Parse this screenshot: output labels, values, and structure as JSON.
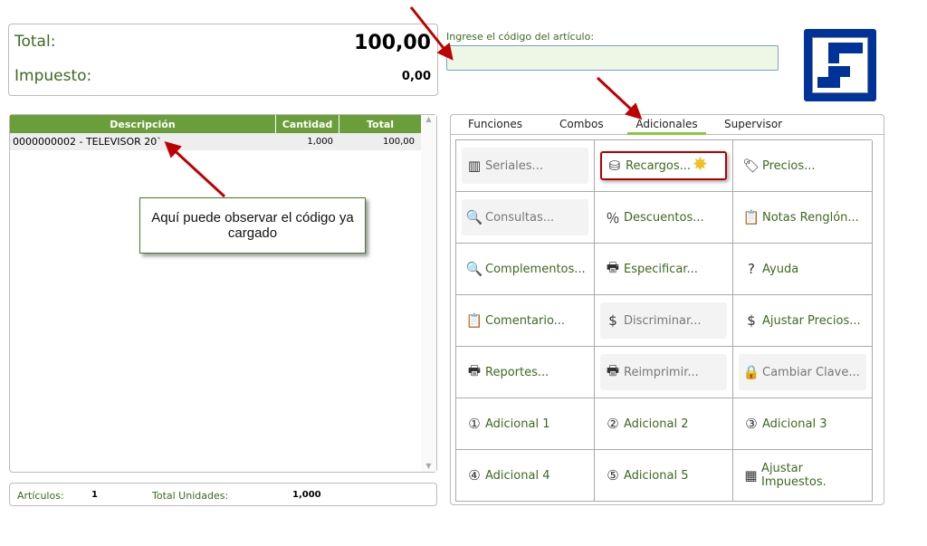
{
  "totals": {
    "total_label": "Total:",
    "total_value": "100,00",
    "tax_label": "Impuesto:",
    "tax_value": "0,00"
  },
  "code": {
    "label": "Ingrese el código del artículo:",
    "value": ""
  },
  "table": {
    "headers": [
      "Descripción",
      "Cantidad",
      "Total"
    ],
    "rows": [
      {
        "desc": "0000000002 - TELEVISOR 20`",
        "qty": "1,000",
        "total": "100,00"
      }
    ]
  },
  "footer": {
    "articles_label": "Artículos:",
    "articles_value": "1",
    "units_label": "Total Unidades:",
    "units_value": "1,000"
  },
  "tabs": [
    "Funciones",
    "Combos",
    "Adicionales",
    "Supervisor"
  ],
  "active_tab": "Adicionales",
  "buttons": [
    {
      "label": "Seriales...",
      "icon": "barcode-icon",
      "glyph": "▥",
      "disabled": true
    },
    {
      "label": "Recargos...",
      "icon": "database-icon",
      "glyph": "⛁",
      "disabled": false
    },
    {
      "label": "Precios...",
      "icon": "price-tag-icon",
      "glyph": "🏷",
      "disabled": false
    },
    {
      "label": "Consultas...",
      "icon": "document-search-icon",
      "glyph": "🔍",
      "disabled": true
    },
    {
      "label": "Descuentos...",
      "icon": "percent-icon",
      "glyph": "％",
      "disabled": false
    },
    {
      "label": "Notas Renglón...",
      "icon": "clipboard-edit-icon",
      "glyph": "📋",
      "disabled": false
    },
    {
      "label": "Complementos...",
      "icon": "document-search-icon",
      "glyph": "🔍",
      "disabled": false
    },
    {
      "label": "Especificar...",
      "icon": "printer-check-icon",
      "glyph": "🖶",
      "disabled": false
    },
    {
      "label": "Ayuda",
      "icon": "help-icon",
      "glyph": "?",
      "disabled": false
    },
    {
      "label": "Comentario...",
      "icon": "clipboard-edit-icon",
      "glyph": "📋",
      "disabled": false
    },
    {
      "label": "Discriminar...",
      "icon": "dollar-document-icon",
      "glyph": "$",
      "disabled": true
    },
    {
      "label": "Ajustar Precios...",
      "icon": "dollar-document-icon",
      "glyph": "$",
      "disabled": false
    },
    {
      "label": "Reportes...",
      "icon": "printer-icon",
      "glyph": "🖶",
      "disabled": false
    },
    {
      "label": "Reimprimir...",
      "icon": "printer-icon",
      "glyph": "🖶",
      "disabled": true
    },
    {
      "label": "Cambiar Clave...",
      "icon": "lock-icon",
      "glyph": "🔒",
      "disabled": true
    },
    {
      "label": "Adicional 1",
      "icon": "number-1-icon",
      "glyph": "①",
      "disabled": false
    },
    {
      "label": "Adicional 2",
      "icon": "number-2-icon",
      "glyph": "②",
      "disabled": false
    },
    {
      "label": "Adicional 3",
      "icon": "number-3-icon",
      "glyph": "③",
      "disabled": false
    },
    {
      "label": "Adicional 4",
      "icon": "number-4-icon",
      "glyph": "④",
      "disabled": false
    },
    {
      "label": "Adicional 5",
      "icon": "number-5-icon",
      "glyph": "⑤",
      "disabled": false
    },
    {
      "label": "Ajustar Impuestos.",
      "icon": "table-icon",
      "glyph": "▦",
      "disabled": false
    }
  ],
  "callout": "Aquí puede observar el código ya cargado",
  "colors": {
    "accent": "#6a9e3a",
    "text": "#3c6a1f",
    "logo": "#003399",
    "highlight": "#b00000"
  }
}
